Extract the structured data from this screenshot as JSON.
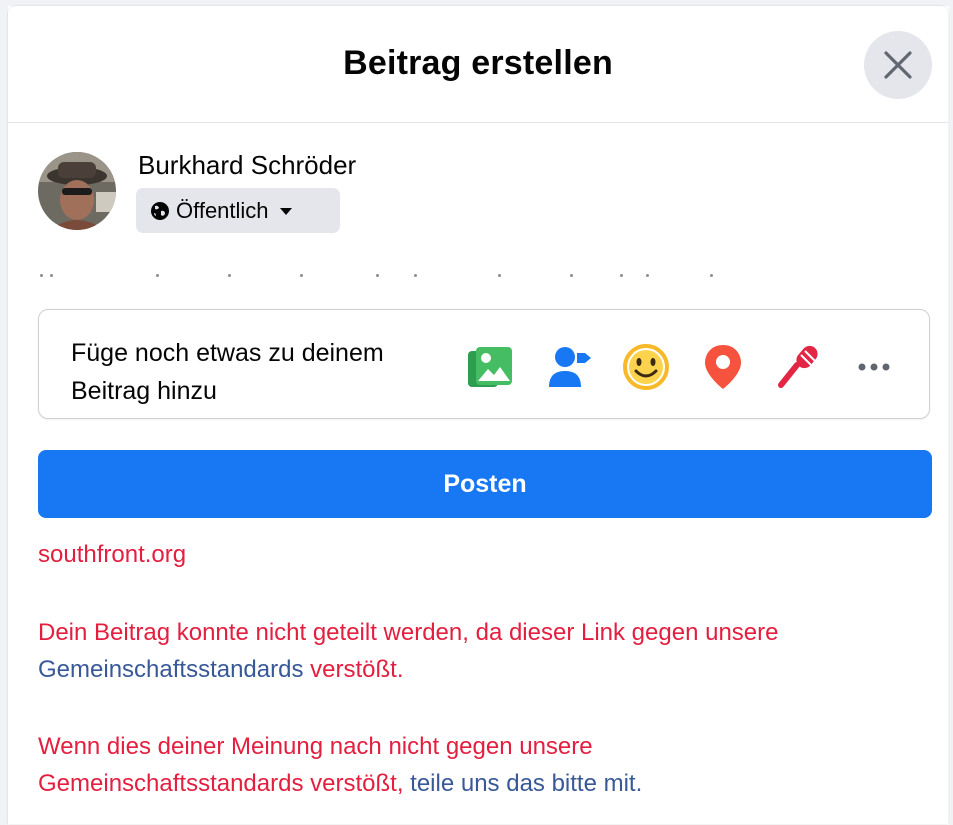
{
  "dialog": {
    "title": "Beitrag erstellen"
  },
  "user": {
    "name": "Burkhard Schröder",
    "audience": "Öffentlich"
  },
  "composer": {
    "add_to_post_line1": "Füge noch etwas zu deinem",
    "add_to_post_line2": "Beitrag hinzu",
    "tools": [
      "photo-video-icon",
      "tag-people-icon",
      "feeling-icon",
      "check-in-icon",
      "live-audio-icon",
      "more-icon"
    ]
  },
  "post_button": "Posten",
  "error": {
    "domain": "southfront.org",
    "message_part1": "Dein Beitrag konnte nicht geteilt werden, da dieser Link gegen unsere",
    "message_link": "Gemeinschaftsstandards",
    "message_part2": " verstößt.",
    "appeal_part1": "Wenn dies deiner Meinung nach nicht gegen unsere",
    "appeal_part2": "Gemeinschaftsstandards verstößt, ",
    "appeal_link": "teile uns das bitte mit."
  },
  "colors": {
    "primary": "#1877f2",
    "error_red": "#e41e3f",
    "link_blue": "#385898",
    "photo_green": "#45bd62",
    "tag_blue": "#1877f2",
    "feeling_yellow": "#f7b928",
    "checkin_red": "#f5533d",
    "live_red": "#e42645"
  }
}
